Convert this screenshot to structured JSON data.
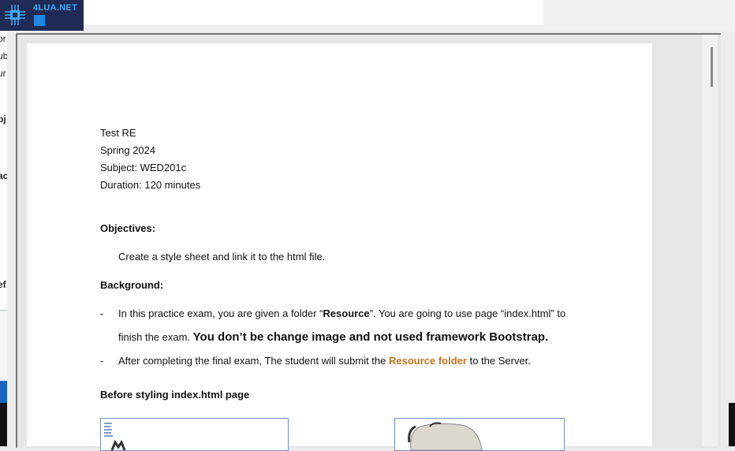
{
  "site": {
    "logo_text": "4LUA.NET"
  },
  "left_fragments": [
    "or",
    "ub",
    "ur",
    "bj",
    "ac",
    "ef"
  ],
  "document": {
    "header": [
      "Test RE",
      "Spring 2024",
      "Subject: WED201c",
      "Duration: 120 minutes"
    ],
    "objectives_heading": "Objectives:",
    "objectives_text": "Create a style sheet and link it to the html file.",
    "background_heading": "Background:",
    "bullet_marker": "-",
    "bullet1_pre": "In this practice exam, you are given a folder “",
    "bullet1_bold": "Resource",
    "bullet1_post": "”. You are going to use page “index.html”  to",
    "bullet1_line2_pre": "finish the exam. ",
    "bullet1_line2_big": "You don’t be change image and not used framework Bootstrap.",
    "bullet2_pre": "After completing the final exam, The student will submit the ",
    "bullet2_orange": "Resource folder",
    "bullet2_post": " to the Server.",
    "before_heading": "Before styling index.html page"
  }
}
